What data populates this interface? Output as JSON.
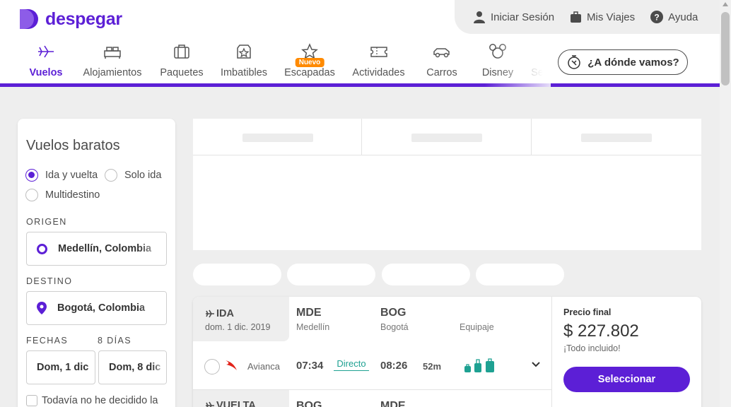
{
  "header": {
    "brand": "despegar",
    "top_links": [
      {
        "label": "Iniciar Sesión",
        "icon": "user-icon"
      },
      {
        "label": "Mis Viajes",
        "icon": "suitcase-icon"
      },
      {
        "label": "Ayuda",
        "icon": "help-icon"
      }
    ],
    "nav": [
      {
        "label": "Vuelos",
        "icon": "plane-icon",
        "active": true
      },
      {
        "label": "Alojamientos",
        "icon": "bed-icon"
      },
      {
        "label": "Paquetes",
        "icon": "luggage-icon"
      },
      {
        "label": "Imbatibles",
        "icon": "badge-star-icon"
      },
      {
        "label": "Escapadas",
        "icon": "star-icon",
        "badge": "Nuevo"
      },
      {
        "label": "Actividades",
        "icon": "ticket-icon"
      },
      {
        "label": "Carros",
        "icon": "car-icon"
      },
      {
        "label": "Disney",
        "icon": "mickey-icon"
      },
      {
        "label": "Se",
        "icon": ""
      }
    ],
    "where_button": "¿A dónde vamos?",
    "accent": "#5c1fd6"
  },
  "sidebar": {
    "title": "Vuelos baratos",
    "trip_types": [
      {
        "label": "Ida y vuelta",
        "checked": true
      },
      {
        "label": "Solo ida",
        "checked": false
      },
      {
        "label": "Multidestino",
        "checked": false
      }
    ],
    "origin_label": "ORIGEN",
    "origin_value": "Medellín, Colombia",
    "destination_label": "DESTINO",
    "destination_value": "Bogotá, Colombia",
    "dates_label": "FECHAS",
    "days_label": "8 DÍAS",
    "date_from": "Dom, 1 dic",
    "date_to": "Dom, 8 dic",
    "undecided_label": "Todavía no he decidido la"
  },
  "result": {
    "outbound": {
      "title": "IDA",
      "date": "dom. 1 dic. 2019",
      "from_code": "MDE",
      "from_city": "Medellín",
      "to_code": "BOG",
      "to_city": "Bogotá",
      "baggage_label": "Equipaje",
      "airline": "Avianca",
      "depart": "07:34",
      "stops": "Directo",
      "arrive": "08:26",
      "duration": "52m"
    },
    "return": {
      "title": "VUELTA",
      "from_code": "BOG",
      "to_code": "MDE"
    },
    "price_label": "Precio final",
    "price": "$ 227.802",
    "price_note": "¡Todo incluido!",
    "select_button": "Seleccionar"
  }
}
